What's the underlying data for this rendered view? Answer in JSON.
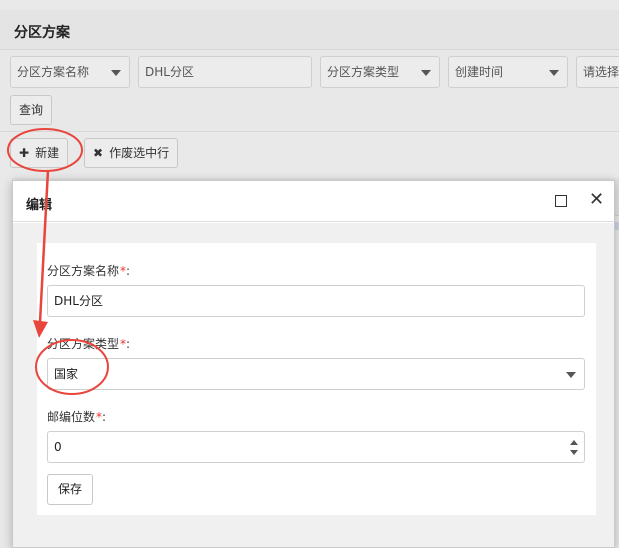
{
  "page": {
    "title": "分区方案"
  },
  "filters": {
    "field1_label": "分区方案名称",
    "field1_value": "DHL分区",
    "field2_label": "分区方案类型",
    "field3_label": "创建时间",
    "field4_placeholder": "请选择"
  },
  "toolbar": {
    "query_label": "查询",
    "new_label": "新建",
    "new_icon": "plus-icon",
    "void_label": "作废选中行",
    "void_icon": "x-icon"
  },
  "dialog": {
    "title": "编辑",
    "name_label": "分区方案名称",
    "name_value": "DHL分区",
    "type_label": "分区方案类型",
    "type_value": "国家",
    "digits_label": "邮编位数",
    "digits_value": "0",
    "required_mark": "*",
    "colon": ":",
    "save_label": "保存"
  },
  "colors": {
    "annotation": "#e8453c",
    "required": "#ee3333"
  }
}
